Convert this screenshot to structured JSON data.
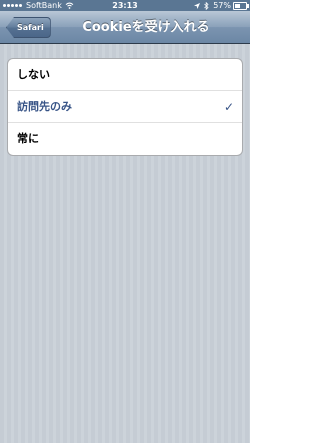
{
  "status_bar": {
    "carrier": "SoftBank",
    "time": "23:13",
    "battery": "57%"
  },
  "nav_bar": {
    "back_label": "Safari",
    "title": "Cookieを受け入れる"
  },
  "options": [
    {
      "label": "しない",
      "selected": false
    },
    {
      "label": "訪問先のみ",
      "selected": true
    },
    {
      "label": "常に",
      "selected": false
    }
  ],
  "checkmark": "✓",
  "icons": {
    "signal": "signal-strength-icon",
    "wifi": "wifi-icon",
    "location": "location-arrow-icon",
    "bluetooth": "bluetooth-icon",
    "battery": "battery-icon",
    "check": "checkmark-icon"
  },
  "colors": {
    "status_bar": "#5a7693",
    "nav_bar": "#7b94b0",
    "selected_text": "#385487",
    "background": "#cbd2d8"
  }
}
